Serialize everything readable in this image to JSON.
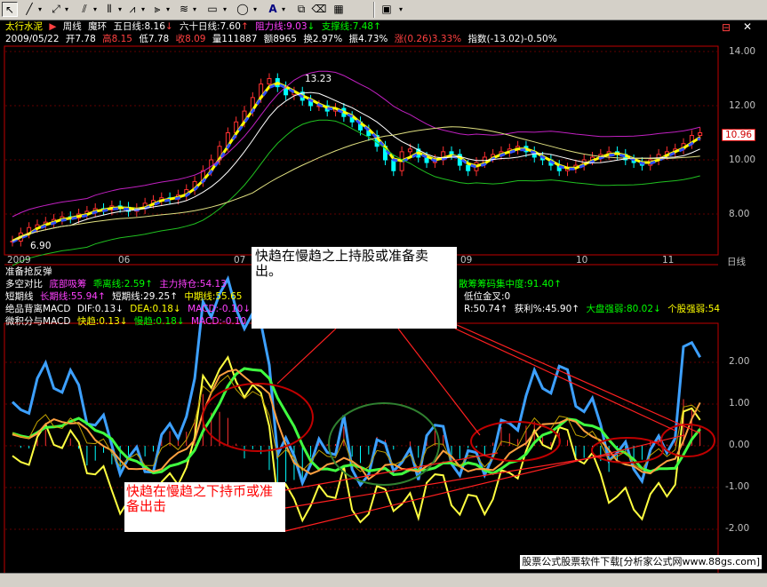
{
  "toolbar": {
    "buttons": [
      "cursor",
      "line",
      "ray",
      "parallel",
      "channel",
      "fibonacci",
      "gann",
      "rect",
      "ellipse",
      "text",
      "copy",
      "erase",
      "palette",
      "save"
    ]
  },
  "header": {
    "stock_name": "太行水泥",
    "period": "周线",
    "indicator": "魔环",
    "ma5_label": "五日线:8.16",
    "ma5_arrow": "↓",
    "ma60_label": "六十日线:7.60",
    "ma60_arrow": "↑",
    "resist_label": "阻力线:9.03",
    "resist_arrow": "↓",
    "support_label": "支撑线:7.48",
    "support_arrow": "↑"
  },
  "quote": {
    "date": "2009/05/22",
    "open": "开7.78",
    "high": "高8.15",
    "low": "低7.78",
    "close": "收8.09",
    "volume": "量111887",
    "amount": "额8965",
    "turnover": "换2.97%",
    "amplitude": "振4.73%",
    "change": "涨(0.26)3.33%",
    "index": "指数(-13.02)-0.50%"
  },
  "price_axis": [
    "14.00",
    "12.00",
    "10.00",
    "8.00"
  ],
  "current_price": "10.96",
  "peak_label": "13.23",
  "low_label": "6.90",
  "time_axis": [
    "2009",
    "06",
    "07",
    "08",
    "09",
    "10",
    "11"
  ],
  "time_axis_right": "日线",
  "indicators": {
    "row1": "准备抢反弹",
    "row2_a": "多空对比",
    "row2_b": "底部吸筹",
    "row2_c": "乖离线:2.59↑",
    "row2_d": "主力持仓:54.13",
    "row2_e": "散筹筹码集中度:91.40↑",
    "row3_a": "短期线",
    "row3_b": "长期线:55.94↑",
    "row3_c": "短期线:29.25↑",
    "row3_d": "中期线:55.65",
    "row3_e": "低位金叉:0",
    "row4_a": "绝品背离MACD",
    "row4_b": "DIF:0.13↓",
    "row4_c": "DEA:0.18↓",
    "row4_d": "MACD:-0.10↓",
    "row4_e": "R:50.74↑",
    "row4_f": "获利%:45.90↑",
    "row4_g": "大盘强弱:80.02↓",
    "row4_h": "个股强弱:54",
    "row5_a": "微积分与MACD",
    "row5_b": "快趋:0.13↓",
    "row5_c": "慢趋:0.18↓",
    "row5_d": "MACD:-0.10"
  },
  "macd_axis": [
    "2.00",
    "1.00",
    "0.00",
    "-1.00",
    "-2.00"
  ],
  "notes": {
    "top": "快趋在慢趋之上持股或准备卖出。",
    "bottom": "快趋在慢趋之下持币或准备出击"
  },
  "footer": "股票公式股票软件下载[分析家公式网www.88gs.com]",
  "colors": {
    "bg": "#000000",
    "up": "#ff3030",
    "down": "#00ffff",
    "ma": "#ffff00"
  }
}
